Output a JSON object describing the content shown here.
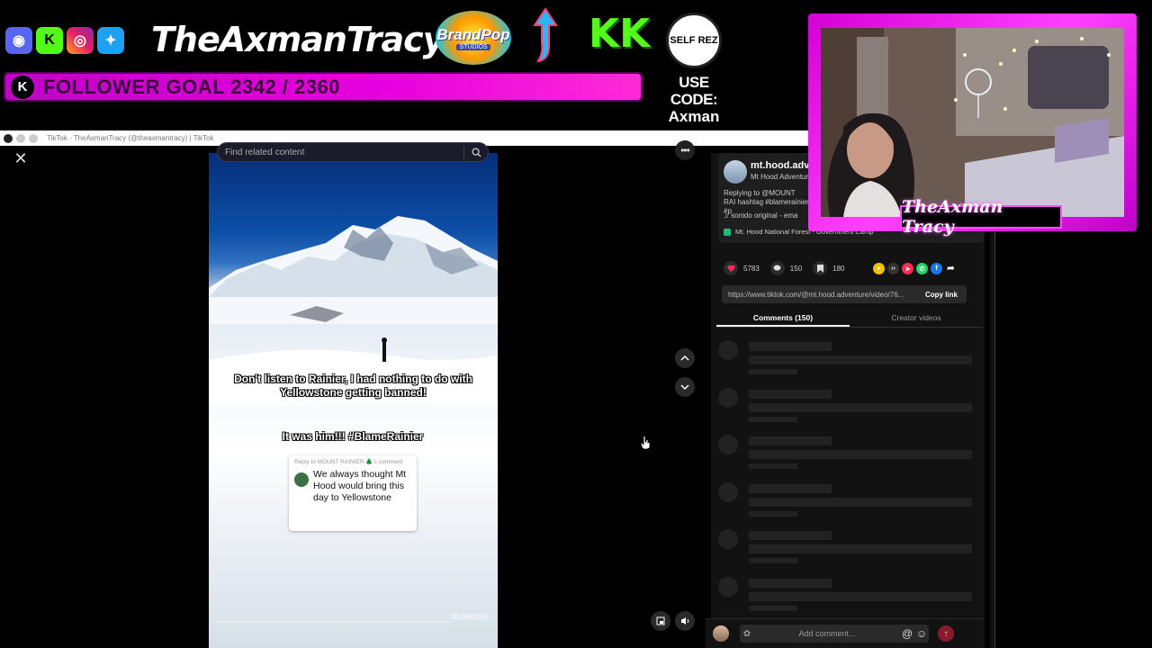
{
  "overlay": {
    "streamer_name": "TheAxmanTracy",
    "sponsor_brandpop_line1": "BrandPop",
    "sponsor_brandpop_line2": "STUDIOS",
    "sponsor_kk": "KK",
    "sponsor_selfrez": "SELF REZ",
    "follower_goal": "FOLLOWER GOAL 2342 / 2360",
    "use_code_label": "USE CODE:",
    "use_code_value": "Axman",
    "webcam_name": "TheAxman Tracy",
    "accent_color": "#ff00ff"
  },
  "browser": {
    "tab_title": "TikTok - TheAxmanTracy (@theaxmantracy) | TikTok"
  },
  "tiktok": {
    "search_placeholder": "Find related content",
    "caption_main": "Don't listen to Rainier, I had nothing to do with Yellowstone getting banned!",
    "caption_sub": "It was him!!! #BlameRainier",
    "reply_meta": "Reply to MOUNT RAINIER 🌲's comment",
    "reply_text": "We always thought Mt Hood would bring this day to Yellowstone",
    "video_time": "00:00/00:00",
    "author_handle": "mt.hood.adve",
    "author_display": "Mt Hood Adventur",
    "description": "Replying to @MOUNT RAI hashtag #blamerainier #p",
    "sound": "♫  sonido original - ema",
    "location": "Mt. Hood National Forest - Government Camp",
    "likes": "5783",
    "comments": "150",
    "saves": "180",
    "link_url": "https://www.tiktok.com/@mt.hood.adventure/video/76...",
    "copy_link_label": "Copy link",
    "tab_comments": "Comments (150)",
    "tab_creator_videos": "Creator videos",
    "comment_placeholder": "Add comment..."
  }
}
